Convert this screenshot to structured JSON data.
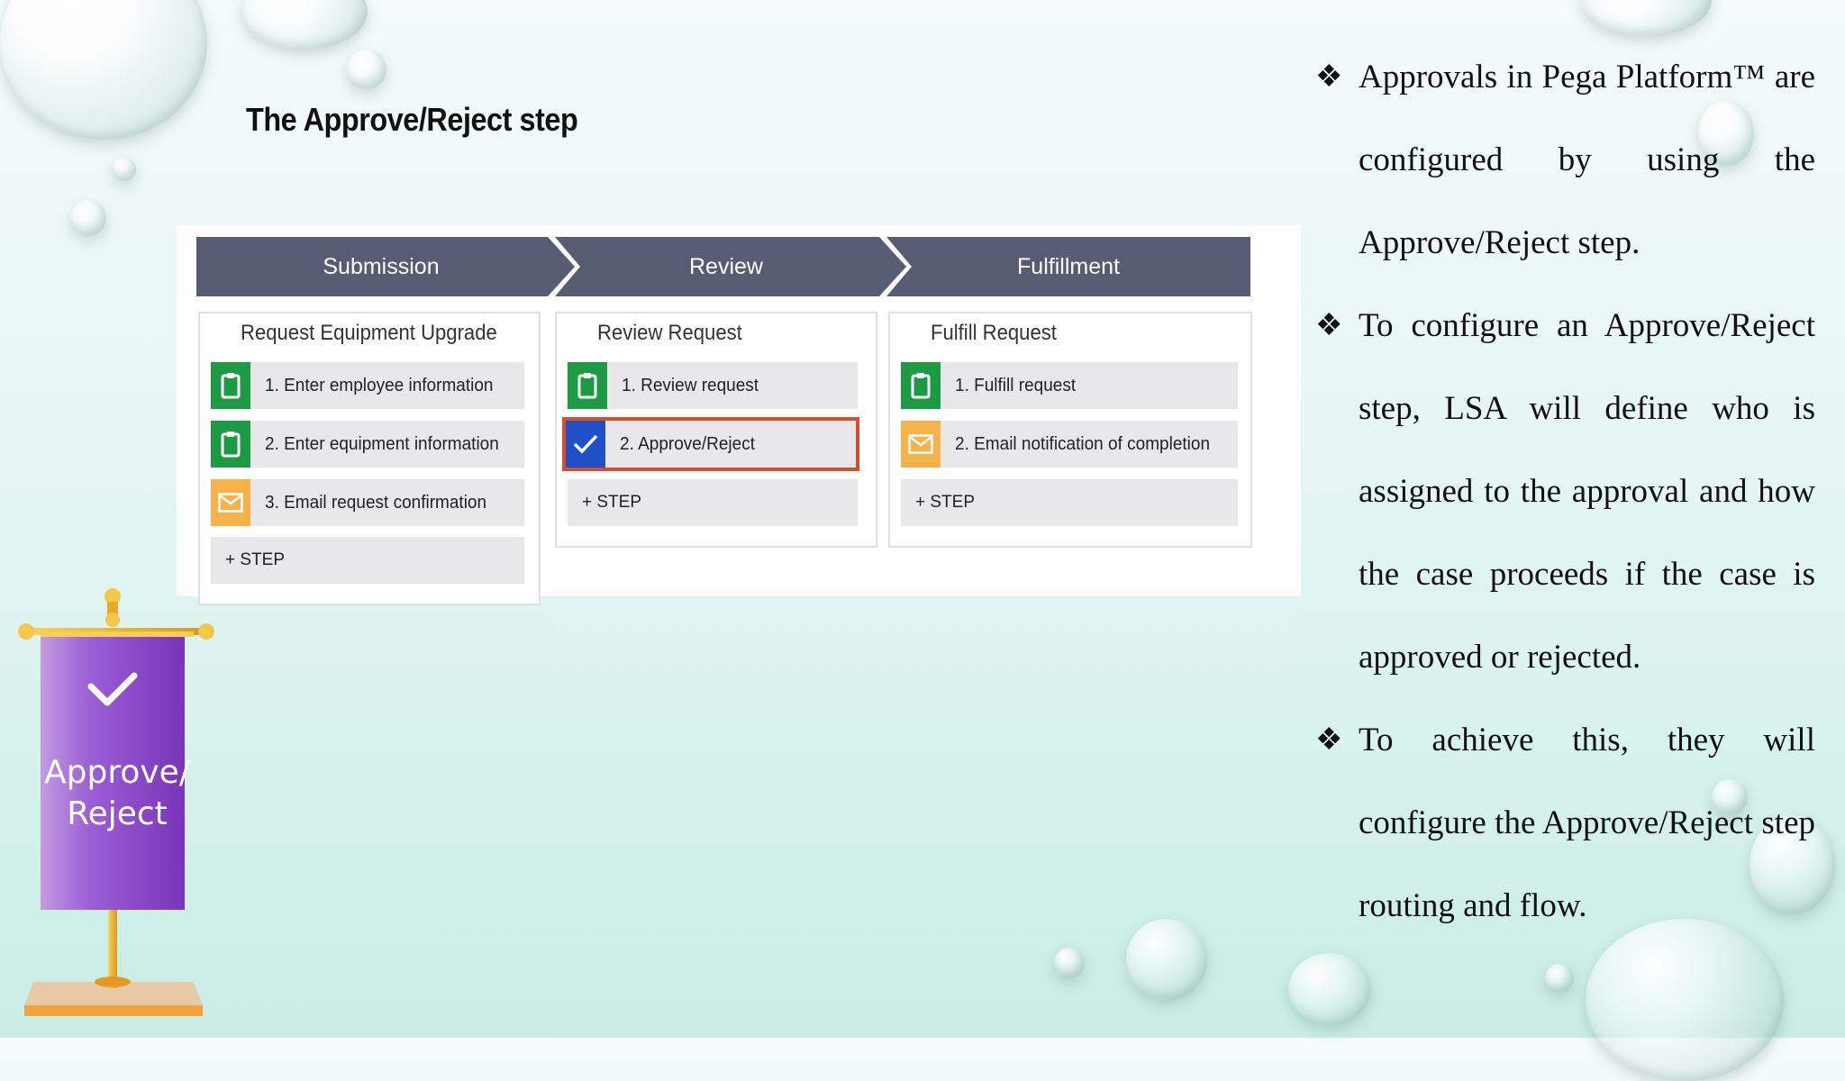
{
  "slide_title": "The Approve/Reject step",
  "stages": [
    {
      "label": "Submission",
      "panel_title": "Request Equipment Upgrade",
      "steps": [
        {
          "label": "1. Enter employee information",
          "icon": "clipboard-icon",
          "color": "#1f9a44"
        },
        {
          "label": "2. Enter equipment information",
          "icon": "clipboard-icon",
          "color": "#1f9a44"
        },
        {
          "label": "3. Email request confirmation",
          "icon": "envelope-icon",
          "color": "#f3b24a"
        }
      ],
      "add_step": "+ STEP"
    },
    {
      "label": "Review",
      "panel_title": "Review Request",
      "steps": [
        {
          "label": "1. Review request",
          "icon": "clipboard-icon",
          "color": "#1f9a44"
        },
        {
          "label": "2. Approve/Reject",
          "icon": "checkmark-icon",
          "color": "#2050c8",
          "selected": true
        }
      ],
      "add_step": "+ STEP"
    },
    {
      "label": "Fulfillment",
      "panel_title": "Fulfill Request",
      "steps": [
        {
          "label": "1. Fulfill request",
          "icon": "clipboard-icon",
          "color": "#1f9a44"
        },
        {
          "label": "2. Email notification of completion",
          "icon": "envelope-icon",
          "color": "#f3b24a"
        }
      ],
      "add_step": "+ STEP"
    }
  ],
  "stage_bar_color": "#585c72",
  "selection_color": "#d4502a",
  "bullet_icon": "diamond-bullet-icon",
  "bullets": [
    {
      "mark": "❖",
      "text": "Approvals in Pega Platform™ are configured by using the Approve/Reject step."
    },
    {
      "mark": "❖",
      "text": "To configure an Approve/Reject step, LSA will define who is assigned to the approval and how the case proceeds if the case is approved or rejected."
    },
    {
      "mark": "❖",
      "text": "To achieve this, they will configure the Approve/Reject step routing and flow."
    }
  ],
  "banner": {
    "icon": "checkmark-icon",
    "line1": "Approve/",
    "line2": "Reject",
    "color": "#8e44c8"
  }
}
